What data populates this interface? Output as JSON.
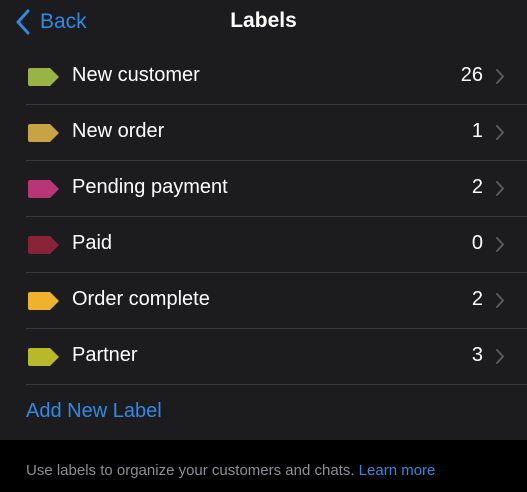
{
  "nav": {
    "back_label": "Back",
    "title": "Labels"
  },
  "labels": [
    {
      "name": "New customer",
      "count": "26",
      "color": "#98b447"
    },
    {
      "name": "New order",
      "count": "1",
      "color": "#c8a343"
    },
    {
      "name": "Pending payment",
      "count": "2",
      "color": "#b83576"
    },
    {
      "name": "Paid",
      "count": "0",
      "color": "#8a2338"
    },
    {
      "name": "Order complete",
      "count": "2",
      "color": "#f0b12c"
    },
    {
      "name": "Partner",
      "count": "3",
      "color": "#b8b82b"
    }
  ],
  "add_label": "Add New Label",
  "footer": {
    "text": "Use labels to organize your customers and chats.",
    "link": "Learn more"
  },
  "colors": {
    "accent": "#2f8ae6",
    "background": "#000000",
    "surface": "#1c1c1e"
  },
  "icons": {
    "back": "chevron-left-icon",
    "row": "chevron-right-icon",
    "tag": "label-tag-icon"
  }
}
